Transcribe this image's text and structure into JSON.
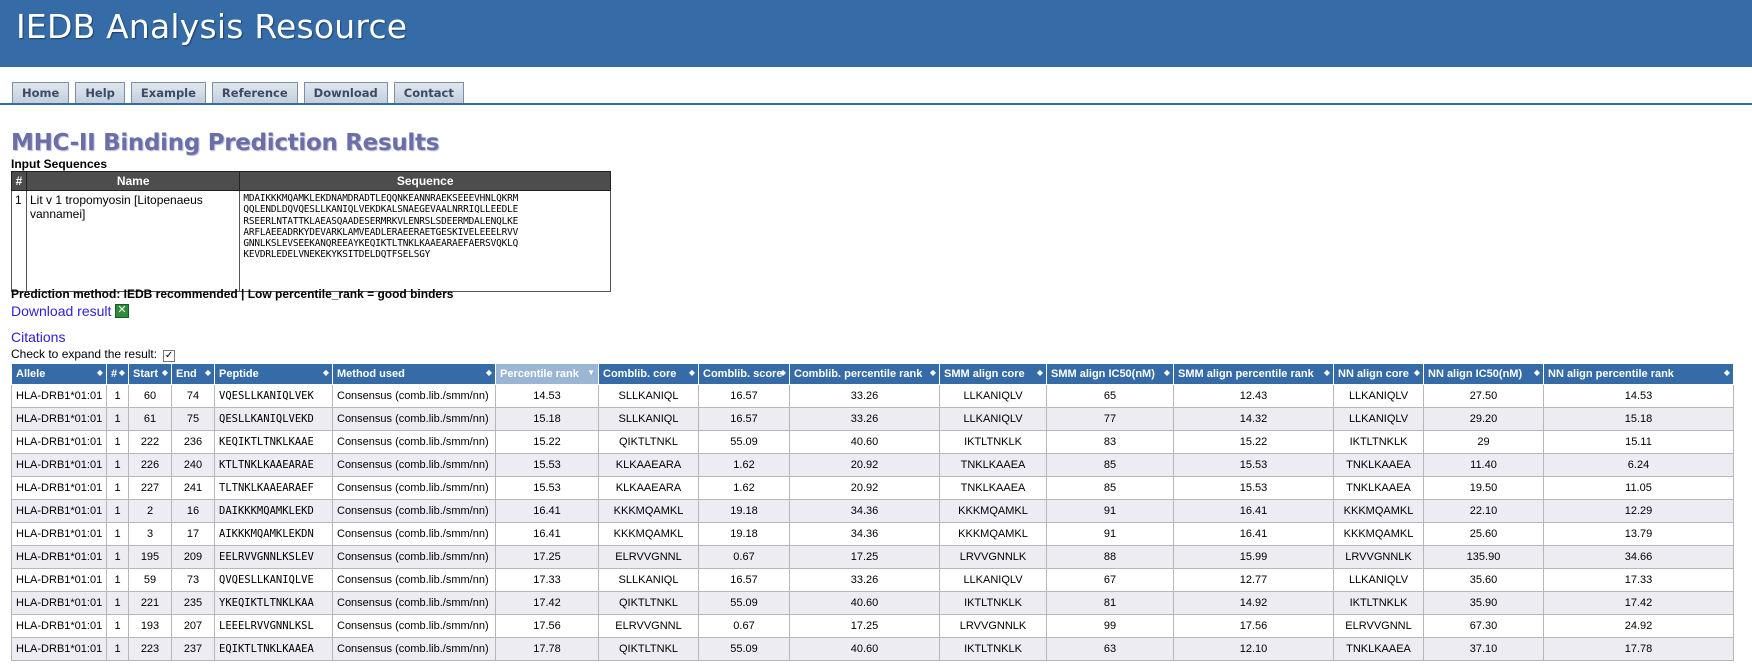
{
  "banner": {
    "title": "IEDB Analysis Resource"
  },
  "nav": {
    "tabs": [
      "Home",
      "Help",
      "Example",
      "Reference",
      "Download",
      "Contact"
    ]
  },
  "page_title": "MHC-II Binding Prediction Results",
  "input": {
    "label": "Input Sequences",
    "headers": [
      "#",
      "Name",
      "Sequence"
    ],
    "row": {
      "num": "1",
      "name": "Lit v 1 tropomyosin [Litopenaeus vannamei]",
      "sequence": "MDAIKKKMQAMKLEKDNAMDRADTLEQQNKEANNRAEKSEEEVHNLQKRM\nQQLENDLDQVQESLLKANIQLVEKDKALSNAEGEVAALNRRIQLLEEDLE\nRSEERLNTATTKLAEASQAADESERMRKVLENRSLSDEERMDALENQLKE\nARFLAEEADRKYDEVARKLAMVEADLERAEERAETGESKIVELEEELRVV\nGNNLKSLEVSEEKANQREEAYKEQIKTLTNKLKAAEARAEFAERSVQKLQ\nKEVDRLEDELVNEKEKYKSITDELDQTFSELSGY"
    }
  },
  "prediction_method": "Prediction method: IEDB recommended | Low percentile_rank = good binders",
  "download_label": "Download result",
  "citations_label": "Citations",
  "expand_label": "Check to expand the result:",
  "results": {
    "headers": [
      "Allele",
      "#",
      "Start",
      "End",
      "Peptide",
      "Method used",
      "Percentile rank",
      "Comblib. core",
      "Comblib. score",
      "Comblib. percentile rank",
      "SMM align core",
      "SMM align IC50(nM)",
      "SMM align percentile rank",
      "NN align core",
      "NN align IC50(nM)",
      "NN align percentile rank"
    ],
    "sorted_column": "Percentile rank",
    "rows": [
      [
        "HLA-DRB1*01:01",
        "1",
        "60",
        "74",
        "VQESLLKANIQLVEK",
        "Consensus (comb.lib./smm/nn)",
        "14.53",
        "SLLKANIQL",
        "16.57",
        "33.26",
        "LLKANIQLV",
        "65",
        "12.43",
        "LLKANIQLV",
        "27.50",
        "14.53"
      ],
      [
        "HLA-DRB1*01:01",
        "1",
        "61",
        "75",
        "QESLLKANIQLVEKD",
        "Consensus (comb.lib./smm/nn)",
        "15.18",
        "SLLKANIQL",
        "16.57",
        "33.26",
        "LLKANIQLV",
        "77",
        "14.32",
        "LLKANIQLV",
        "29.20",
        "15.18"
      ],
      [
        "HLA-DRB1*01:01",
        "1",
        "222",
        "236",
        "KEQIKTLTNKLKAAE",
        "Consensus (comb.lib./smm/nn)",
        "15.22",
        "QIKTLTNKL",
        "55.09",
        "40.60",
        "IKTLTNKLK",
        "83",
        "15.22",
        "IKTLTNKLK",
        "29",
        "15.11"
      ],
      [
        "HLA-DRB1*01:01",
        "1",
        "226",
        "240",
        "KTLTNKLKAAEARAE",
        "Consensus (comb.lib./smm/nn)",
        "15.53",
        "KLKAAEARA",
        "1.62",
        "20.92",
        "TNKLKAAEA",
        "85",
        "15.53",
        "TNKLKAAEA",
        "11.40",
        "6.24"
      ],
      [
        "HLA-DRB1*01:01",
        "1",
        "227",
        "241",
        "TLTNKLKAAEARAEF",
        "Consensus (comb.lib./smm/nn)",
        "15.53",
        "KLKAAEARA",
        "1.62",
        "20.92",
        "TNKLKAAEA",
        "85",
        "15.53",
        "TNKLKAAEA",
        "19.50",
        "11.05"
      ],
      [
        "HLA-DRB1*01:01",
        "1",
        "2",
        "16",
        "DAIKKKMQAMKLEKD",
        "Consensus (comb.lib./smm/nn)",
        "16.41",
        "KKKMQAMKL",
        "19.18",
        "34.36",
        "KKKMQAMKL",
        "91",
        "16.41",
        "KKKMQAMKL",
        "22.10",
        "12.29"
      ],
      [
        "HLA-DRB1*01:01",
        "1",
        "3",
        "17",
        "AIKKKMQAMKLEKDN",
        "Consensus (comb.lib./smm/nn)",
        "16.41",
        "KKKMQAMKL",
        "19.18",
        "34.36",
        "KKKMQAMKL",
        "91",
        "16.41",
        "KKKMQAMKL",
        "25.60",
        "13.79"
      ],
      [
        "HLA-DRB1*01:01",
        "1",
        "195",
        "209",
        "EELRVVGNNLKSLEV",
        "Consensus (comb.lib./smm/nn)",
        "17.25",
        "ELRVVGNNL",
        "0.67",
        "17.25",
        "LRVVGNNLK",
        "88",
        "15.99",
        "LRVVGNNLK",
        "135.90",
        "34.66"
      ],
      [
        "HLA-DRB1*01:01",
        "1",
        "59",
        "73",
        "QVQESLLKANIQLVE",
        "Consensus (comb.lib./smm/nn)",
        "17.33",
        "SLLKANIQL",
        "16.57",
        "33.26",
        "LLKANIQLV",
        "67",
        "12.77",
        "LLKANIQLV",
        "35.60",
        "17.33"
      ],
      [
        "HLA-DRB1*01:01",
        "1",
        "221",
        "235",
        "YKEQIKTLTNKLKAA",
        "Consensus (comb.lib./smm/nn)",
        "17.42",
        "QIKTLTNKL",
        "55.09",
        "40.60",
        "IKTLTNKLK",
        "81",
        "14.92",
        "IKTLTNKLK",
        "35.90",
        "17.42"
      ],
      [
        "HLA-DRB1*01:01",
        "1",
        "193",
        "207",
        "LEEELRVVGNNLKSL",
        "Consensus (comb.lib./smm/nn)",
        "17.56",
        "ELRVVGNNL",
        "0.67",
        "17.25",
        "LRVVGNNLK",
        "99",
        "17.56",
        "ELRVVGNNL",
        "67.30",
        "24.92"
      ],
      [
        "HLA-DRB1*01:01",
        "1",
        "223",
        "237",
        "EQIKTLTNKLKAAEA",
        "Consensus (comb.lib./smm/nn)",
        "17.78",
        "QIKTLTNKL",
        "55.09",
        "40.60",
        "IKTLTNKLK",
        "63",
        "12.10",
        "TNKLKAAEA",
        "37.10",
        "17.78"
      ]
    ]
  }
}
